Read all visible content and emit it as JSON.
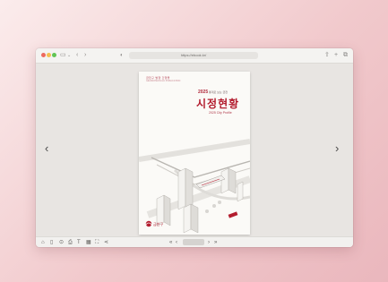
{
  "browser": {
    "url": "https://ebook.kr/"
  },
  "cover": {
    "header_line1": "금천구 발행 간행물",
    "header_line2": "GEUMCHEON-GU PUBLICATION",
    "year_badge": "2025",
    "year_caption": "통계로 보는 금천",
    "title": "시정현황",
    "subtitle": "2025 City Profile",
    "publisher": "금천구"
  },
  "viewer": {
    "prev_arrow": "‹",
    "next_arrow": "›"
  },
  "icons": {
    "titlebar": [
      "sidebar-icon",
      "chevron-left-icon",
      "chevron-right-icon",
      "shield-icon",
      "share-icon",
      "plus-icon",
      "tabs-icon"
    ],
    "toolbar": [
      "home-icon",
      "bookmark-icon",
      "search-icon",
      "print-icon",
      "text-icon",
      "grid-icon",
      "fullscreen-icon",
      "share-icon",
      "first-page-icon",
      "prev-page-icon",
      "next-page-icon",
      "last-page-icon"
    ]
  }
}
